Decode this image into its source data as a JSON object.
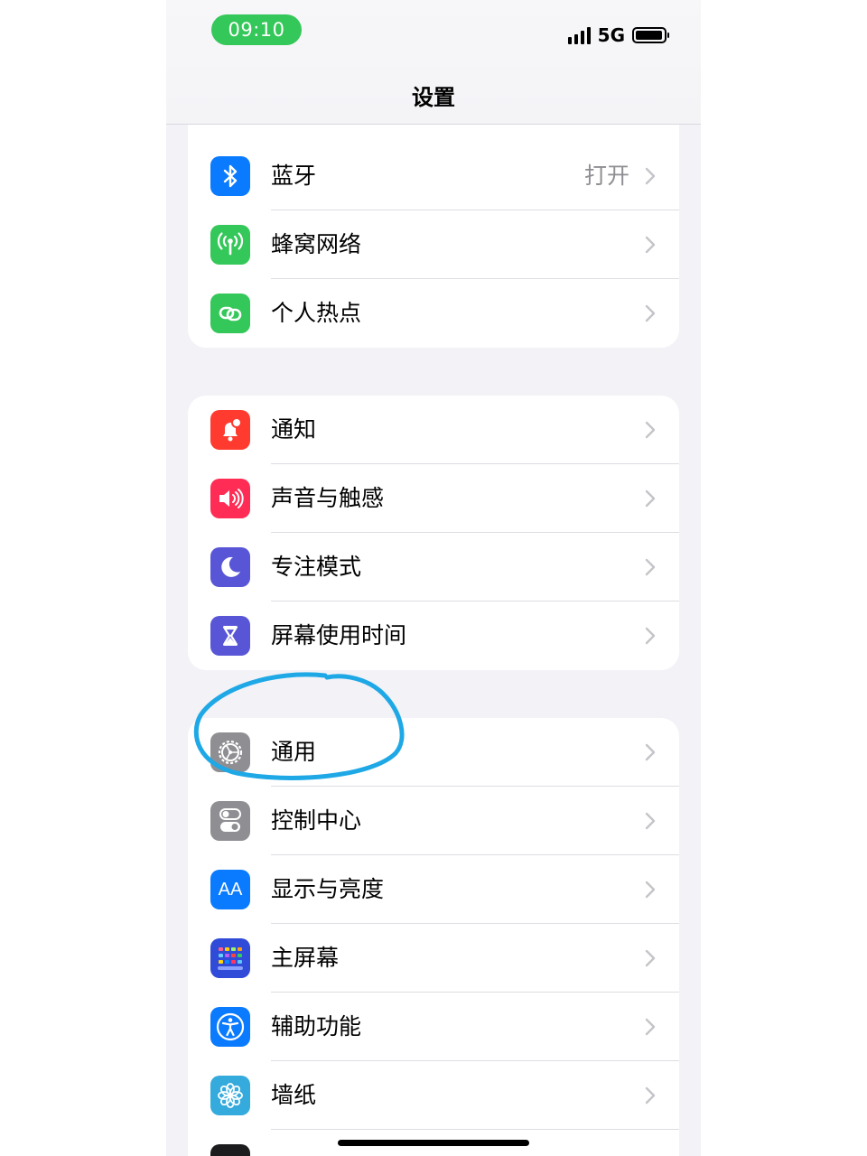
{
  "status_bar": {
    "time": "09:10",
    "network": "5G"
  },
  "header": {
    "title": "设置"
  },
  "groups": [
    {
      "rows": [
        {
          "label": "蓝牙",
          "value": "打开",
          "icon": "bluetooth-icon",
          "color": "#0a7aff"
        },
        {
          "label": "蜂窝网络",
          "icon": "cellular-icon",
          "color": "#34c759"
        },
        {
          "label": "个人热点",
          "icon": "hotspot-icon",
          "color": "#34c759"
        }
      ]
    },
    {
      "rows": [
        {
          "label": "通知",
          "icon": "notification-bell-icon",
          "color": "#ff3b30"
        },
        {
          "label": "声音与触感",
          "icon": "speaker-icon",
          "color": "#ff2d55"
        },
        {
          "label": "专注模式",
          "icon": "moon-icon",
          "color": "#5856d6"
        },
        {
          "label": "屏幕使用时间",
          "icon": "hourglass-icon",
          "color": "#5856d6"
        }
      ]
    },
    {
      "rows": [
        {
          "label": "通用",
          "icon": "gear-icon",
          "color": "#8e8e93"
        },
        {
          "label": "控制中心",
          "icon": "toggles-icon",
          "color": "#8e8e93"
        },
        {
          "label": "显示与亮度",
          "icon": "text-size-icon",
          "color": "#0a7aff",
          "icon_text": "AA"
        },
        {
          "label": "主屏幕",
          "icon": "home-screen-grid-icon",
          "color": "#2f4bd8"
        },
        {
          "label": "辅助功能",
          "icon": "accessibility-icon",
          "color": "#0a7aff"
        },
        {
          "label": "墙纸",
          "icon": "flower-icon",
          "color": "#35aadc"
        }
      ]
    }
  ],
  "annotation": {
    "color": "#1fa8e6",
    "target": "通用"
  }
}
